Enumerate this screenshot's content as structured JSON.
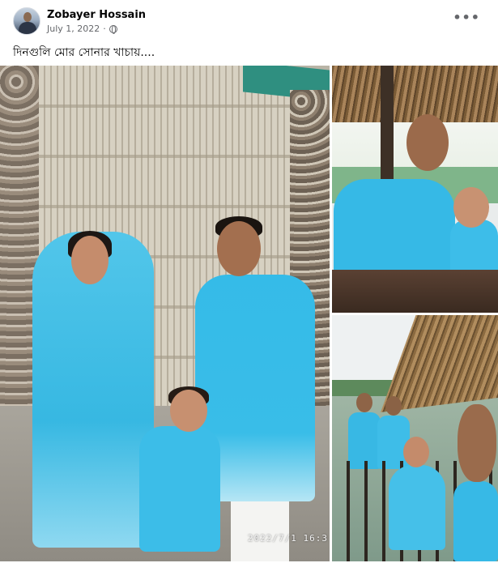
{
  "post": {
    "author": "Zobayer Hossain",
    "date": "July 1, 2022",
    "separator": "·",
    "privacy_icon": "globe-icon",
    "more_label": "•••",
    "caption": "দিনগুলি মোর সোনার খাচায়...."
  },
  "photos": {
    "main_timestamp": "2022/7/1 16:3"
  },
  "colors": {
    "outfit_blue": "#35b9e6",
    "meta_gray": "#65676b"
  }
}
